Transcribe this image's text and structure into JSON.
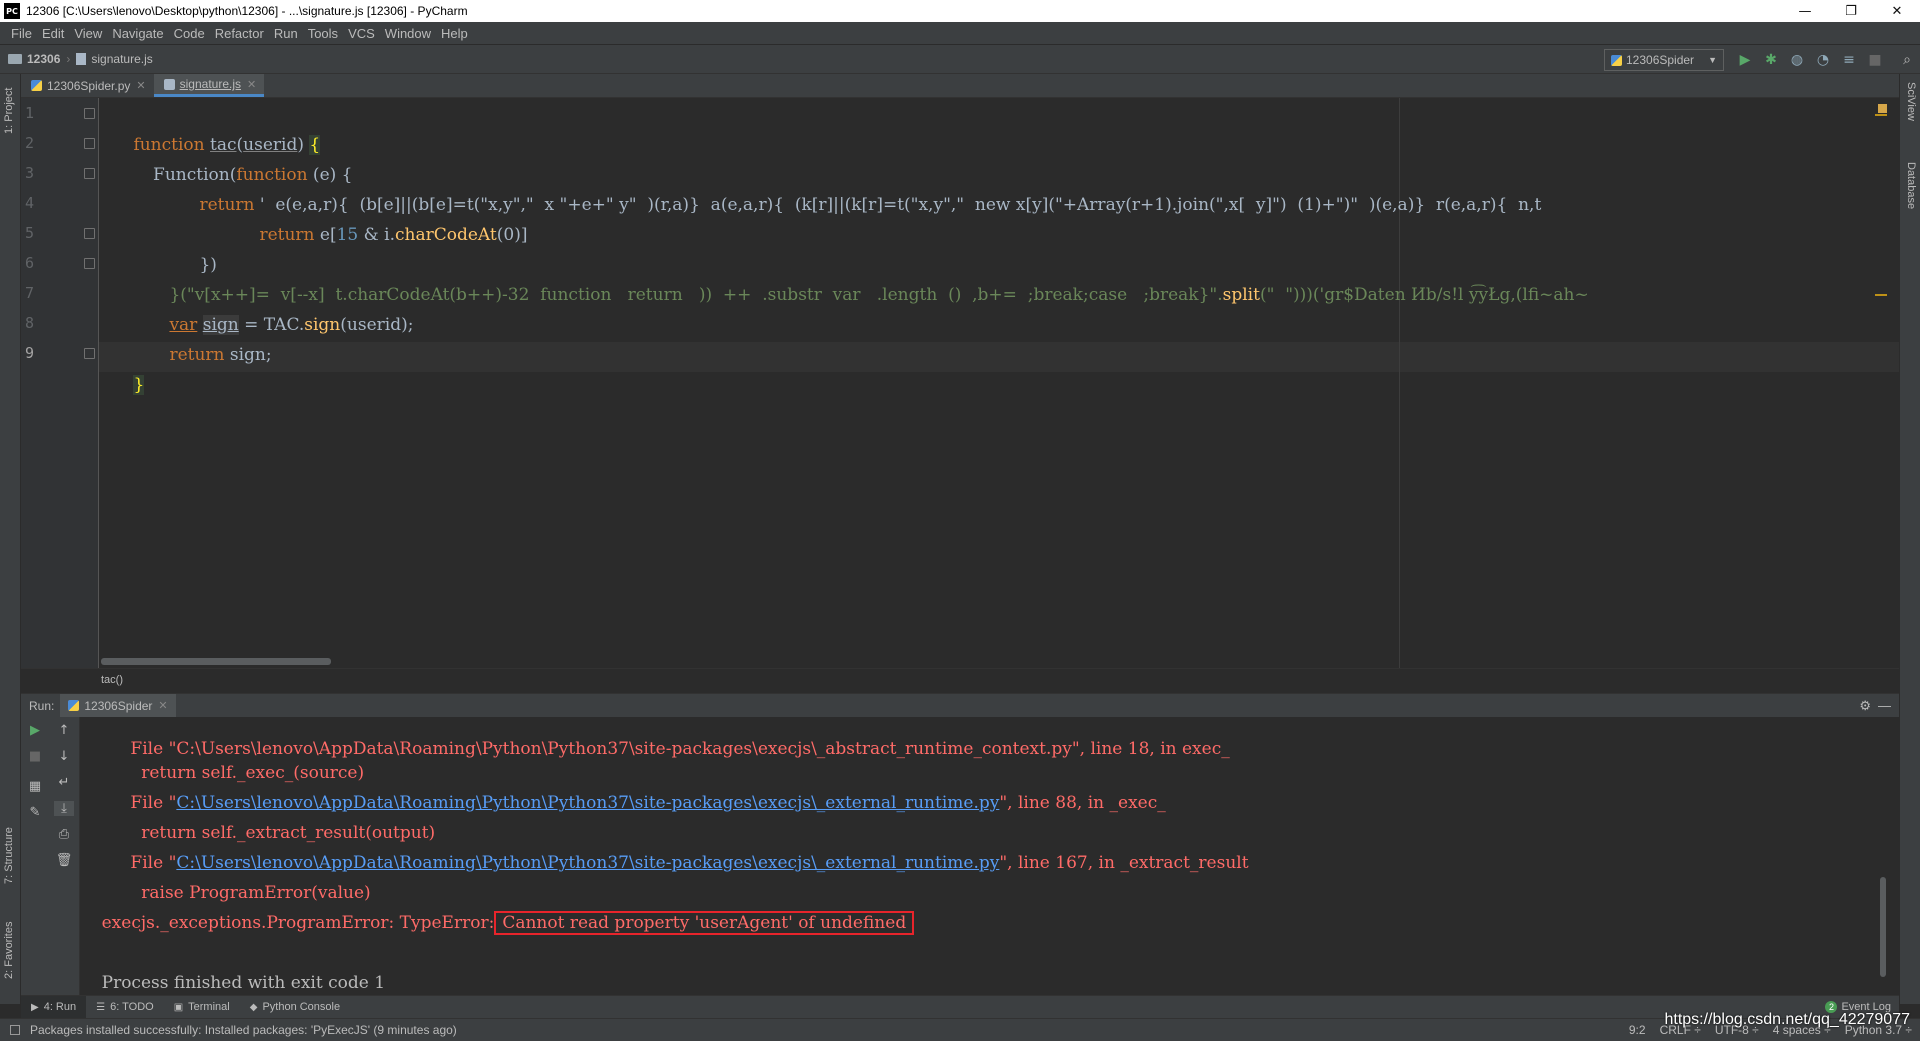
{
  "window": {
    "title": "12306 [C:\\Users\\lenovo\\Desktop\\python\\12306] - ...\\signature.js [12306] - PyCharm",
    "logo_text": "PC",
    "controls": [
      "—",
      "❐",
      "✕"
    ]
  },
  "menu": [
    "File",
    "Edit",
    "View",
    "Navigate",
    "Code",
    "Refactor",
    "Run",
    "Tools",
    "VCS",
    "Window",
    "Help"
  ],
  "nav": {
    "project": "12306",
    "file": "signature.js",
    "run_config": "12306Spider"
  },
  "side_panels": {
    "left": [
      "1: Project",
      "7: Structure",
      "2: Favorites"
    ],
    "right": [
      "SciView",
      "Database"
    ]
  },
  "tabs": [
    {
      "label": "12306Spider.py",
      "active": false
    },
    {
      "label": "signature.js",
      "active": true
    }
  ],
  "editor": {
    "line_numbers": [
      "1",
      "2",
      "3",
      "4",
      "5",
      "6",
      "7",
      "8",
      "9"
    ],
    "lines": {
      "l1": {
        "kw": "function",
        "name": "tac",
        "open": "(",
        "param": "userid",
        "close": ") ",
        "brace": "{"
      },
      "l2": {
        "text_a": "    Function(",
        "kw": "function",
        "text_b": " (e) {"
      },
      "l3": {
        "kw": "return",
        "text": " '  e(e,a,r){  (b[e]||(b[e]=t(\"x,y\",\"  x \"+e+\" y\"  )(r,a)}  a(e,a,r){  (k[r]||(k[r]=t(\"x,y\",\"  new x[y](\"+Array(r+1).join(\",x[  y]\")  (1)+\")\"  )(e,a)}  r(e,a,r){  n,t"
      },
      "l4": {
        "kw": "return",
        "text_a": " e[",
        "num": "15",
        "text_b": " & i.",
        "fn": "charCodeAt",
        "text_c": "(0)]"
      },
      "l5": {
        "text": "})"
      },
      "l6": {
        "str": "}(\"v[x++]=  v[--x]  t.charCodeAt(b++)-32  function   return   ))  ++  .substr  var   .length  ()  ,b+=  ;break;case   ;break}\".",
        "fn": "split",
        "text": "(\"  \")))('gr$Daten Иb/s!l y͡yŁg,(lfi~ah~"
      },
      "l7": {
        "kw": "var",
        "var": "sign",
        "text_a": " = TAC.",
        "fn": "sign",
        "text_b": "(userid);"
      },
      "l8": {
        "kw": "return",
        "text": " sign;"
      },
      "l9": {
        "brace": "}"
      }
    },
    "breadcrumb": "tac()"
  },
  "run": {
    "label": "Run:",
    "tab": "12306Spider",
    "console": {
      "partial_top": "  File \"C:\\Users\\lenovo\\AppData\\Roaming\\Python\\Python37\\site-packages\\execjs\\_abstract_runtime_context.py\", line 18, in exec_",
      "l1": "    return self._exec_(source)",
      "l2_pre": "  File \"",
      "l2_link": "C:\\Users\\lenovo\\AppData\\Roaming\\Python\\Python37\\site-packages\\execjs\\_external_runtime.py",
      "l2_post": "\", line 88, in _exec_",
      "l3": "    return self._extract_result(output)",
      "l4_pre": "  File \"",
      "l4_link": "C:\\Users\\lenovo\\AppData\\Roaming\\Python\\Python37\\site-packages\\execjs\\_external_runtime.py",
      "l4_post": "\", line 167, in _extract_result",
      "l5": "    raise ProgramError(value)",
      "l6_pre": "execjs._exceptions.ProgramError: TypeError:",
      "l6_boxed": "Cannot read property 'userAgent' of undefined",
      "l7": "Process finished with exit code 1"
    }
  },
  "bottom_tabs": [
    {
      "label": "4: Run",
      "icon": "▶",
      "active": true
    },
    {
      "label": "6: TODO",
      "icon": "☰",
      "active": false
    },
    {
      "label": "Terminal",
      "icon": "▣",
      "active": false
    },
    {
      "label": "Python Console",
      "icon": "◆",
      "active": false
    }
  ],
  "event_log": {
    "count": "2",
    "label": "Event Log"
  },
  "status": {
    "message": "Packages installed successfully: Installed packages: 'PyExecJS' (9 minutes ago)",
    "position": "9:2",
    "line_sep": "CRLF ÷",
    "encoding": "UTF-8 ÷",
    "indent": "4 spaces ÷",
    "interpreter": "Python 3.7 ÷"
  },
  "watermark": "https://blog.csdn.net/qq_42279077",
  "colors": {
    "keyword": "#cc7832",
    "function": "#ffc66d",
    "string": "#6a8759",
    "number": "#6897bb",
    "error": "#ff6b68",
    "link": "#589df6",
    "highlight_box": "#e8242b"
  }
}
